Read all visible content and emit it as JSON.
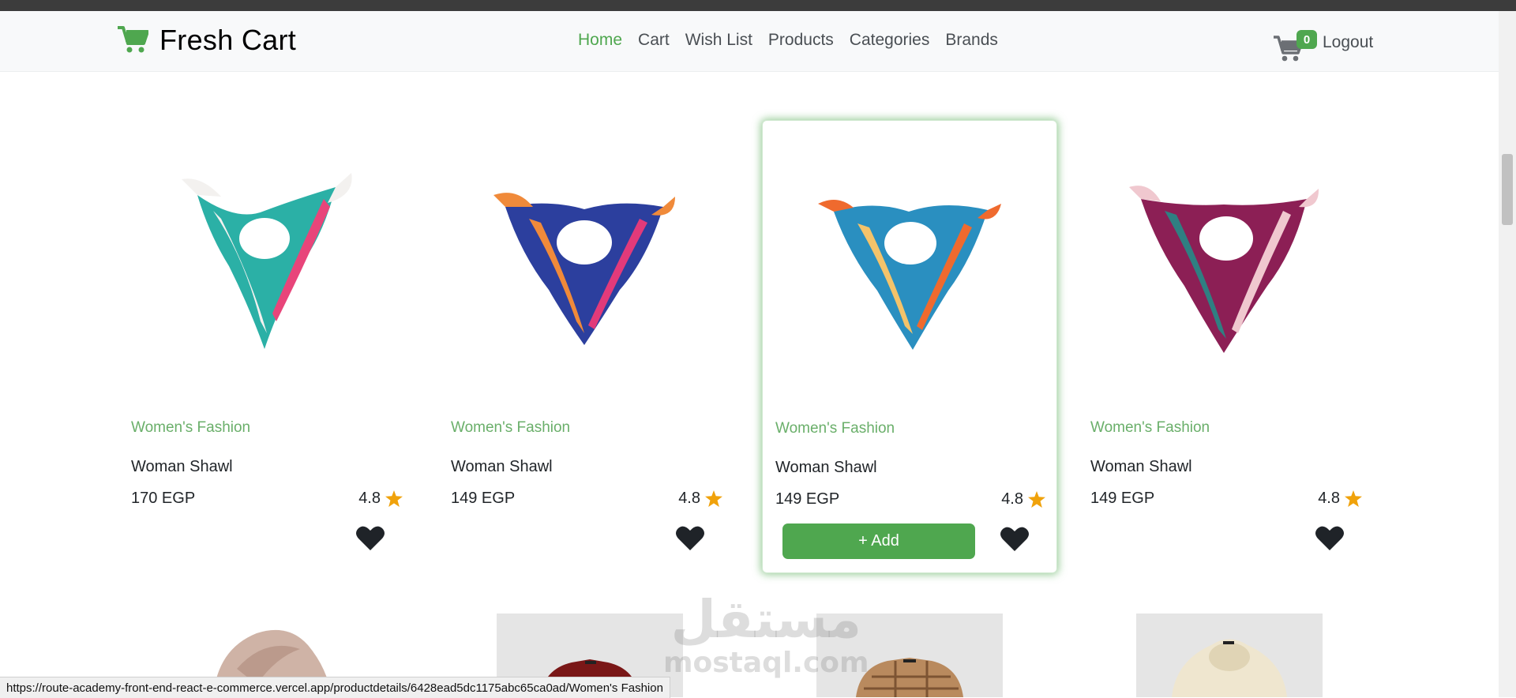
{
  "brand": {
    "name": "Fresh Cart",
    "icon": "cart-icon",
    "color": "#4fa74f"
  },
  "nav": {
    "links": [
      {
        "label": "Home",
        "active": true
      },
      {
        "label": "Cart",
        "active": false
      },
      {
        "label": "Wish List",
        "active": false
      },
      {
        "label": "Products",
        "active": false
      },
      {
        "label": "Categories",
        "active": false
      },
      {
        "label": "Brands",
        "active": false
      }
    ],
    "cart_count": "0",
    "logout_label": "Logout"
  },
  "products": [
    {
      "category": "Women's Fashion",
      "title": "Woman Shawl",
      "price": "170 EGP",
      "rating": "4.8",
      "colors": [
        "#2bb0a6",
        "#f3f1ef",
        "#e8457a"
      ]
    },
    {
      "category": "Women's Fashion",
      "title": "Woman Shawl",
      "price": "149 EGP",
      "rating": "4.8",
      "colors": [
        "#2c3f9e",
        "#e23a7a",
        "#f08a3a"
      ]
    },
    {
      "category": "Women's Fashion",
      "title": "Woman Shawl",
      "price": "149 EGP",
      "rating": "4.8",
      "colors": [
        "#2a8fc0",
        "#ef6a2e",
        "#f4c36a"
      ]
    },
    {
      "category": "Women's Fashion",
      "title": "Woman Shawl",
      "price": "149 EGP",
      "rating": "4.8",
      "colors": [
        "#8c1f55",
        "#f0c8cf",
        "#2f7f82"
      ]
    }
  ],
  "add_button_label": "+ Add",
  "status_url": "https://route-academy-front-end-react-e-commerce.vercel.app/productdetails/6428ead5dc1175abc65ca0ad/Women's Fashion",
  "watermark": {
    "arabic": "مستقل",
    "latin": "mostaql.com"
  }
}
